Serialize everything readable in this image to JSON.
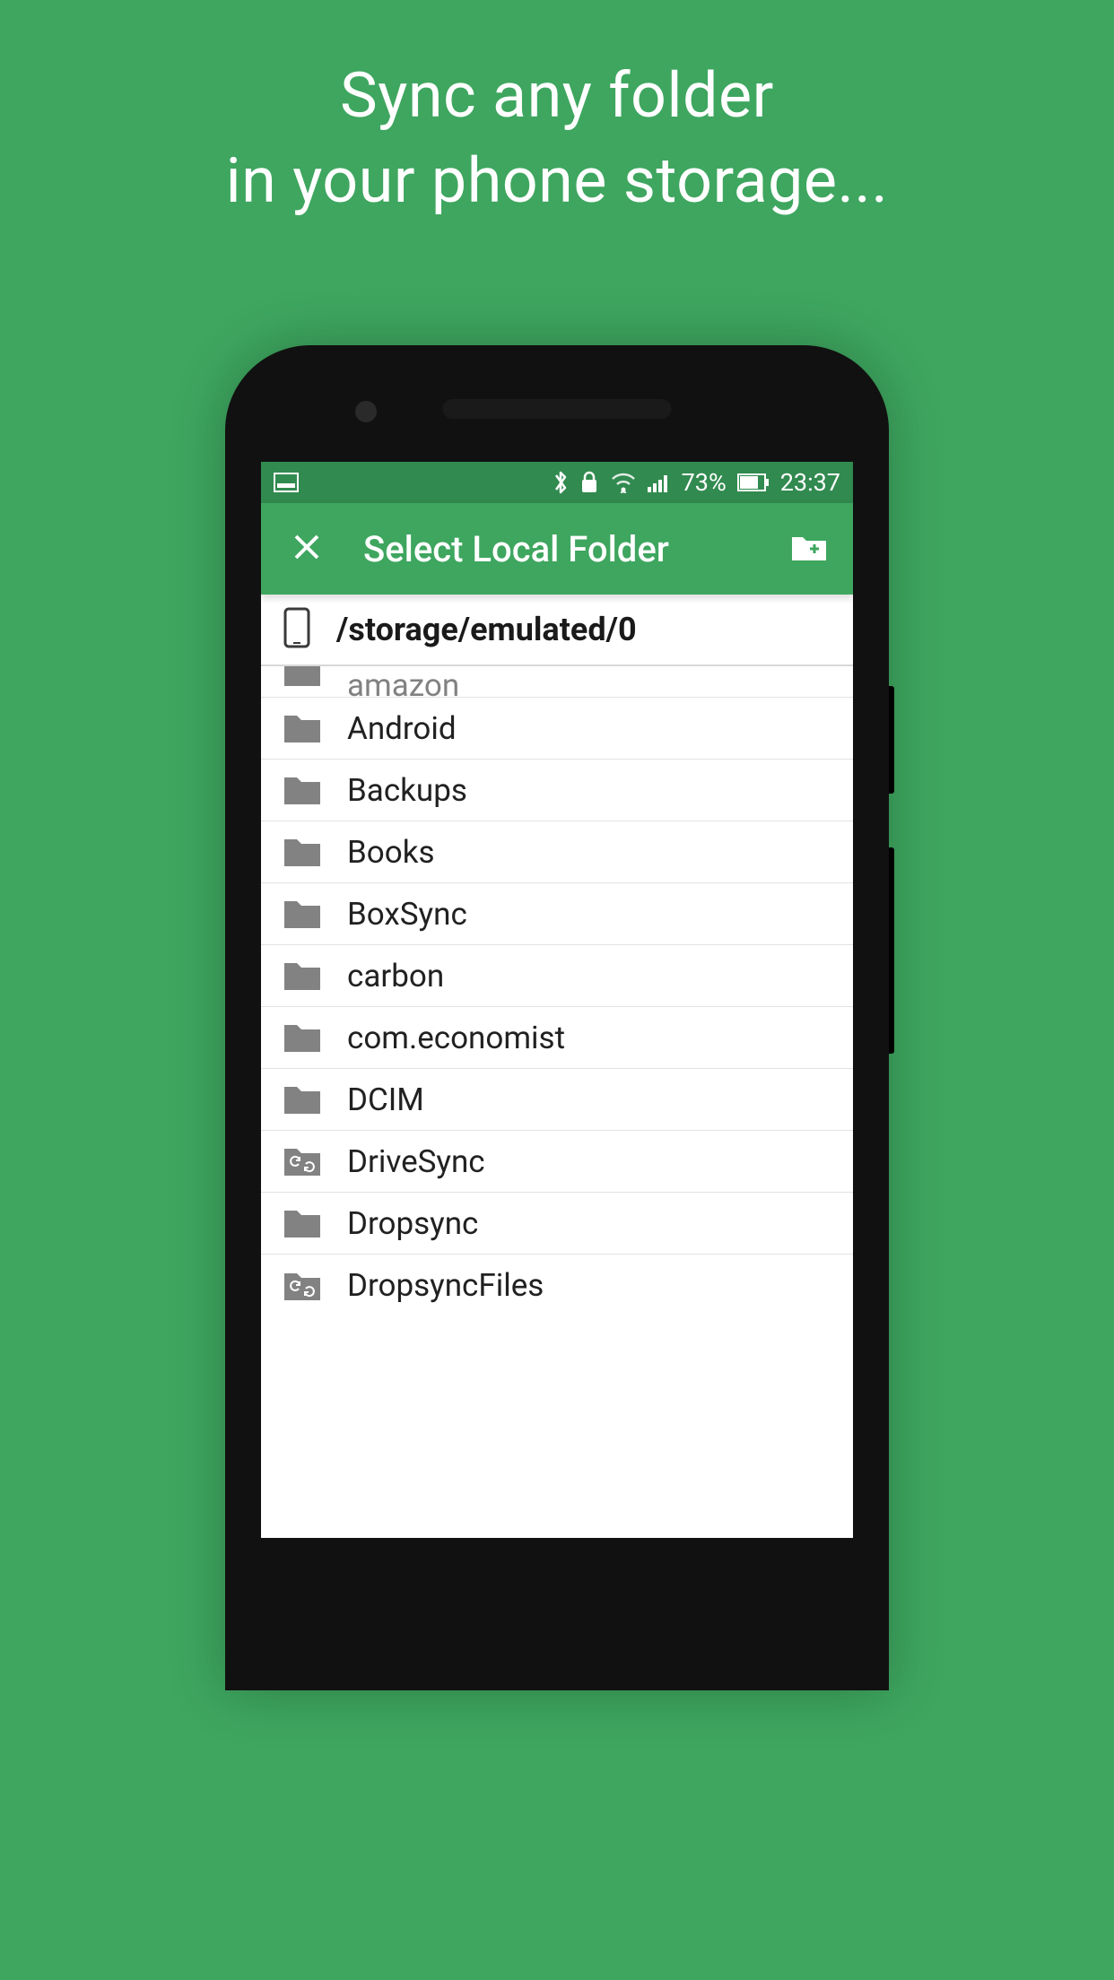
{
  "promo": {
    "line1": "Sync any folder",
    "line2": "in your phone storage..."
  },
  "statusbar": {
    "battery_percent": "73%",
    "time": "23:37"
  },
  "appbar": {
    "title": "Select Local Folder"
  },
  "path": "/storage/emulated/0",
  "folders": [
    {
      "name": "amazon",
      "icon": "folder"
    },
    {
      "name": "Android",
      "icon": "folder"
    },
    {
      "name": "Backups",
      "icon": "folder"
    },
    {
      "name": "Books",
      "icon": "folder"
    },
    {
      "name": "BoxSync",
      "icon": "folder"
    },
    {
      "name": "carbon",
      "icon": "folder"
    },
    {
      "name": "com.economist",
      "icon": "folder"
    },
    {
      "name": "DCIM",
      "icon": "folder"
    },
    {
      "name": "DriveSync",
      "icon": "folder-sync"
    },
    {
      "name": "Dropsync",
      "icon": "folder"
    },
    {
      "name": "DropsyncFiles",
      "icon": "folder-sync"
    }
  ]
}
